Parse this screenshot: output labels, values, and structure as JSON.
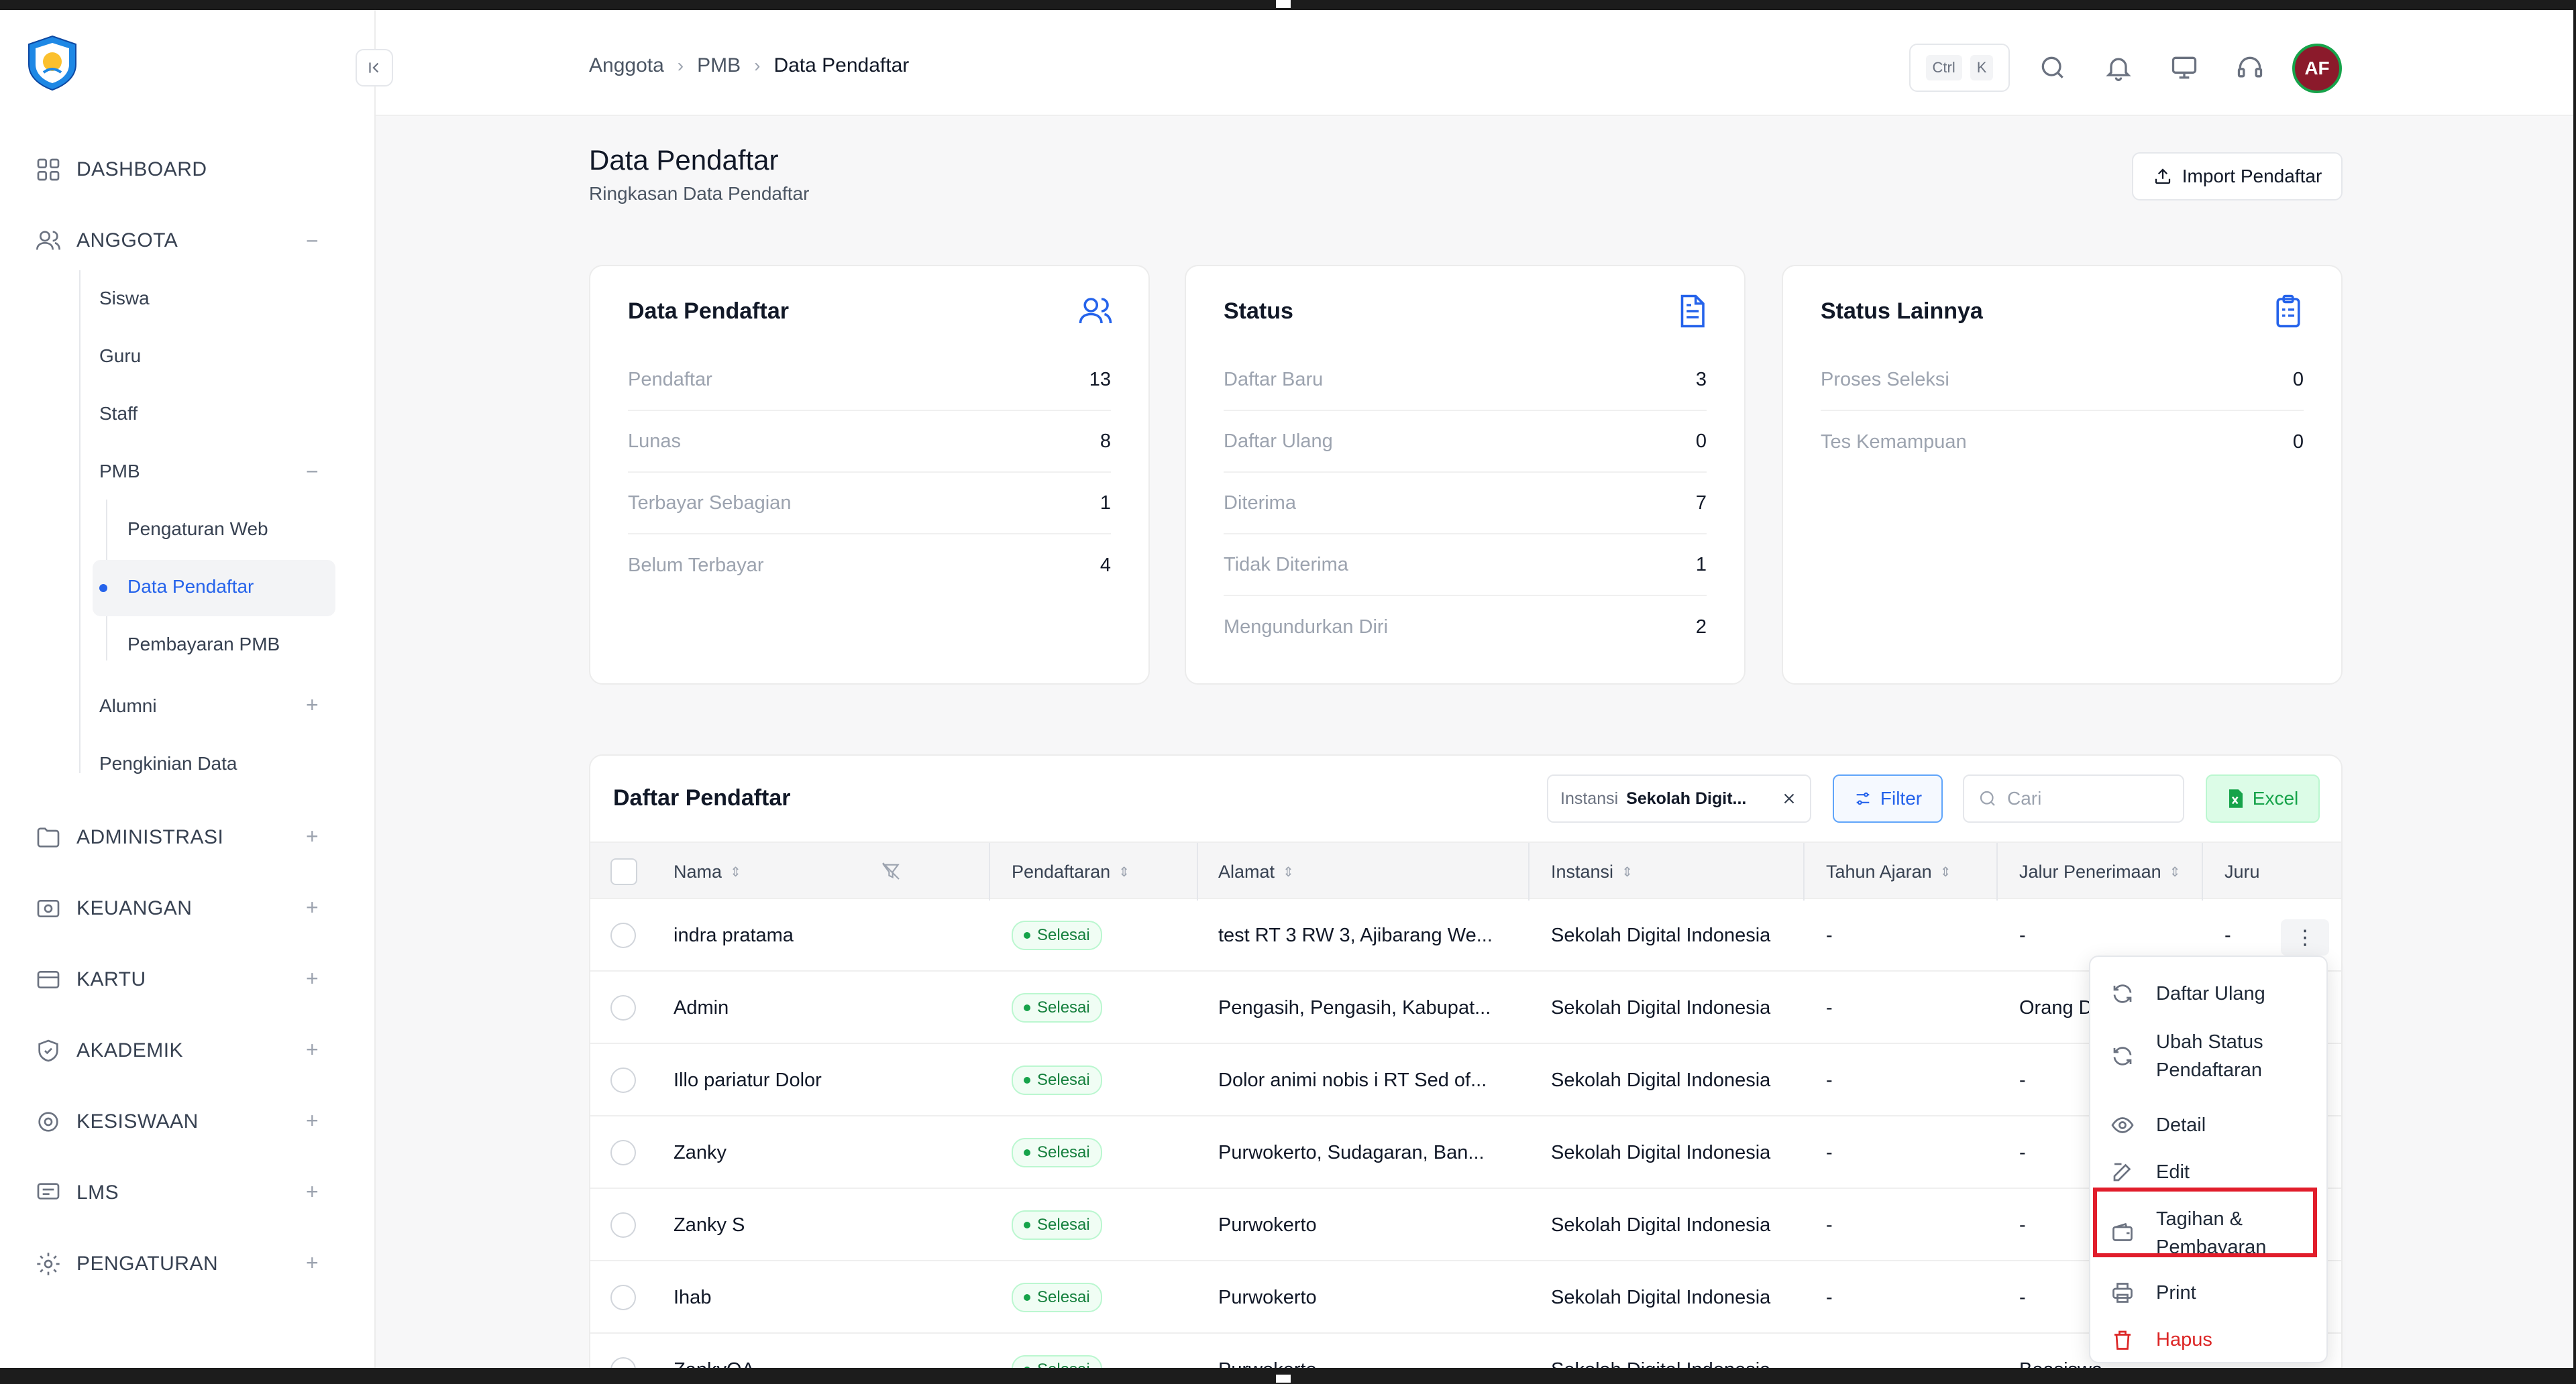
{
  "sidebar": {
    "main_items": [
      {
        "label": "DASHBOARD",
        "icon": "grid-icon"
      },
      {
        "label": "ANGGOTA",
        "icon": "users-icon",
        "toggle": "−"
      },
      {
        "label": "ADMINISTRASI",
        "icon": "folder-icon",
        "toggle": "+"
      },
      {
        "label": "KEUANGAN",
        "icon": "wallet-icon",
        "toggle": "+"
      },
      {
        "label": "KARTU",
        "icon": "card-icon",
        "toggle": "+"
      },
      {
        "label": "AKADEMIK",
        "icon": "shield-icon",
        "toggle": "+"
      },
      {
        "label": "KESISWAAN",
        "icon": "badge-icon",
        "toggle": "+"
      },
      {
        "label": "LMS",
        "icon": "screen-icon",
        "toggle": "+"
      },
      {
        "label": "PENGATURAN",
        "icon": "gear-icon",
        "toggle": "+"
      }
    ],
    "anggota_sub": [
      "Siswa",
      "Guru",
      "Staff",
      "PMB",
      "Alumni",
      "Pengkinian Data"
    ],
    "pmb_toggle": "−",
    "alumni_toggle": "+",
    "pmb_sub": [
      "Pengaturan Web",
      "Data Pendaftar",
      "Pembayaran PMB"
    ]
  },
  "header": {
    "breadcrumb": [
      "Anggota",
      "PMB",
      "Data Pendaftar"
    ],
    "kbd_ctrl": "Ctrl",
    "kbd_k": "K",
    "avatar": "AF"
  },
  "page": {
    "title": "Data Pendaftar",
    "subtitle": "Ringkasan Data Pendaftar",
    "import_label": "Import Pendaftar"
  },
  "cards": [
    {
      "title": "Data Pendaftar",
      "icon": "users-icon",
      "rows": [
        {
          "label": "Pendaftar",
          "value": "13"
        },
        {
          "label": "Lunas",
          "value": "8"
        },
        {
          "label": "Terbayar Sebagian",
          "value": "1"
        },
        {
          "label": "Belum Terbayar",
          "value": "4"
        }
      ]
    },
    {
      "title": "Status",
      "icon": "document-icon",
      "rows": [
        {
          "label": "Daftar Baru",
          "value": "3"
        },
        {
          "label": "Daftar Ulang",
          "value": "0"
        },
        {
          "label": "Diterima",
          "value": "7"
        },
        {
          "label": "Tidak Diterima",
          "value": "1"
        },
        {
          "label": "Mengundurkan Diri",
          "value": "2"
        }
      ]
    },
    {
      "title": "Status Lainnya",
      "icon": "clipboard-icon",
      "rows": [
        {
          "label": "Proses Seleksi",
          "value": "0"
        },
        {
          "label": "Tes Kemampuan",
          "value": "0"
        }
      ]
    }
  ],
  "table": {
    "title": "Daftar Pendaftar",
    "chip_key": "Instansi",
    "chip_value": "Sekolah Digit...",
    "filter_label": "Filter",
    "search_placeholder": "Cari",
    "excel_label": "Excel",
    "columns": [
      "Nama",
      "Pendaftaran",
      "Alamat",
      "Instansi",
      "Tahun Ajaran",
      "Jalur Penerimaan",
      "Juru"
    ],
    "rows": [
      {
        "nama": "indra pratama",
        "status": "Selesai",
        "alamat": "test RT 3 RW 3, Ajibarang We...",
        "instansi": "Sekolah Digital Indonesia",
        "tahun": "-",
        "jalur": "-",
        "juru": "-"
      },
      {
        "nama": "Admin",
        "status": "Selesai",
        "alamat": "Pengasih, Pengasih, Kabupat...",
        "instansi": "Sekolah Digital Indonesia",
        "tahun": "-",
        "jalur": "Orang D",
        "juru": ""
      },
      {
        "nama": "Illo pariatur Dolor",
        "status": "Selesai",
        "alamat": "Dolor animi nobis i RT Sed of...",
        "instansi": "Sekolah Digital Indonesia",
        "tahun": "-",
        "jalur": "-",
        "juru": ""
      },
      {
        "nama": "Zanky",
        "status": "Selesai",
        "alamat": "Purwokerto, Sudagaran, Ban...",
        "instansi": "Sekolah Digital Indonesia",
        "tahun": "-",
        "jalur": "-",
        "juru": ""
      },
      {
        "nama": "Zanky S",
        "status": "Selesai",
        "alamat": "Purwokerto",
        "instansi": "Sekolah Digital Indonesia",
        "tahun": "-",
        "jalur": "-",
        "juru": ""
      },
      {
        "nama": "Ihab",
        "status": "Selesai",
        "alamat": "Purwokerto",
        "instansi": "Sekolah Digital Indonesia",
        "tahun": "-",
        "jalur": "-",
        "juru": ""
      },
      {
        "nama": "ZankyQA",
        "status": "Selesai",
        "alamat": "Purwokerto",
        "instansi": "Sekolah Digital Indonesia",
        "tahun": "-",
        "jalur": "Beasiswa",
        "juru": "-"
      }
    ]
  },
  "menu": {
    "items": [
      {
        "label": "Daftar Ulang",
        "icon": "refresh-icon"
      },
      {
        "label": "Ubah Status Pendaftaran",
        "icon": "refresh-icon"
      },
      {
        "label": "Detail",
        "icon": "eye-icon"
      },
      {
        "label": "Edit",
        "icon": "edit-icon"
      },
      {
        "label": "Tagihan & Pembayaran",
        "icon": "wallet-icon"
      },
      {
        "label": "Print",
        "icon": "printer-icon"
      },
      {
        "label": "Hapus",
        "icon": "trash-icon"
      }
    ]
  },
  "colors": {
    "accent": "#2563eb",
    "success": "#16a34a",
    "danger": "#dc2626",
    "highlight": "#e11d2b",
    "avatar_bg": "#8b1a2b"
  }
}
